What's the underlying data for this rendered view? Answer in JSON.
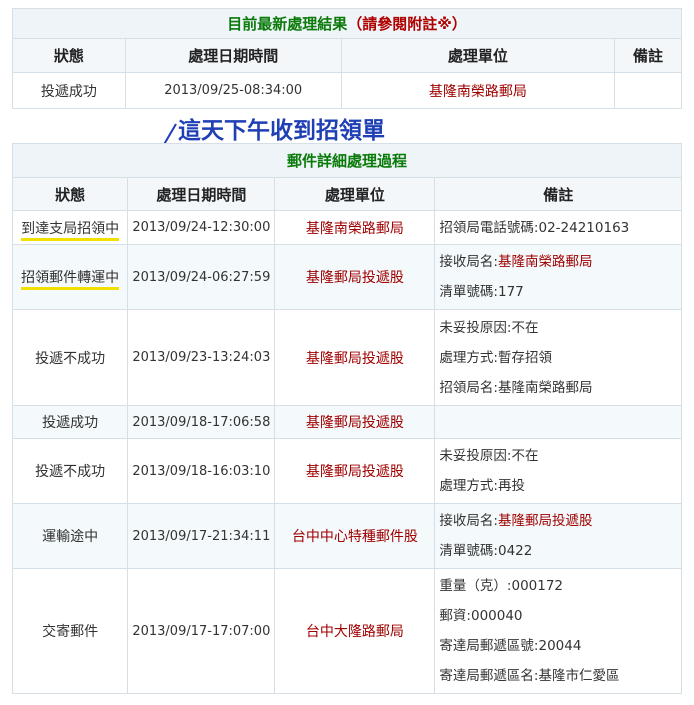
{
  "latest": {
    "title": "目前最新處理結果",
    "note": "（請參閱附註※）",
    "headers": [
      "狀態",
      "處理日期時間",
      "處理單位",
      "備註"
    ],
    "row": {
      "status": "投遞成功",
      "datetime": "2013/09/25-08:34:00",
      "unit": "基隆南榮路郵局",
      "remark": ""
    }
  },
  "annotation": {
    "text": "這天下午收到招領單"
  },
  "detail": {
    "title": "郵件詳細處理過程",
    "headers": [
      "狀態",
      "處理日期時間",
      "處理單位",
      "備註"
    ],
    "rows": [
      {
        "status": "到達支局招領中",
        "datetime": "2013/09/24-12:30:00",
        "unit": "基隆南榮路郵局",
        "remarks": [
          {
            "label": "招領局電話號碼:",
            "value": "02-24210163"
          }
        ]
      },
      {
        "status": "招領郵件轉運中",
        "datetime": "2013/09/24-06:27:59",
        "unit": "基隆郵局投遞股",
        "remarks": [
          {
            "label": "接收局名:",
            "value": "基隆南榮路郵局"
          },
          {
            "label": "清單號碼:",
            "value": "177"
          }
        ]
      },
      {
        "status": "投遞不成功",
        "datetime": "2013/09/23-13:24:03",
        "unit": "基隆郵局投遞股",
        "remarks": [
          {
            "label": "未妥投原因:",
            "value": "不在"
          },
          {
            "label": "處理方式:",
            "value": "暫存招領"
          },
          {
            "label": "招領局名:",
            "value": "基隆南榮路郵局"
          }
        ]
      },
      {
        "status": "投遞成功",
        "datetime": "2013/09/18-17:06:58",
        "unit": "基隆郵局投遞股",
        "remarks": []
      },
      {
        "status": "投遞不成功",
        "datetime": "2013/09/18-16:03:10",
        "unit": "基隆郵局投遞股",
        "remarks": [
          {
            "label": "未妥投原因:",
            "value": "不在"
          },
          {
            "label": "處理方式:",
            "value": "再投"
          }
        ]
      },
      {
        "status": "運輸途中",
        "datetime": "2013/09/17-21:34:11",
        "unit": "台中中心特種郵件股",
        "remarks": [
          {
            "label": "接收局名:",
            "value": "基隆郵局投遞股"
          },
          {
            "label": "清單號碼:",
            "value": "0422"
          }
        ]
      },
      {
        "status": "交寄郵件",
        "datetime": "2013/09/17-17:07:00",
        "unit": "台中大隆路郵局",
        "remarks": [
          {
            "label": "重量（克）:",
            "value": "000172"
          },
          {
            "label": "郵資:",
            "value": "000040"
          },
          {
            "label": "寄達局郵遞區號:",
            "value": "20044"
          },
          {
            "label": "寄達局郵遞區名:",
            "value": "基隆市仁愛區"
          }
        ]
      }
    ]
  },
  "colors": {
    "section_title": "#0a7a0a",
    "unit_text": "#a00000",
    "annotation": "#1f3fb5",
    "highlight": "#f2e000"
  }
}
